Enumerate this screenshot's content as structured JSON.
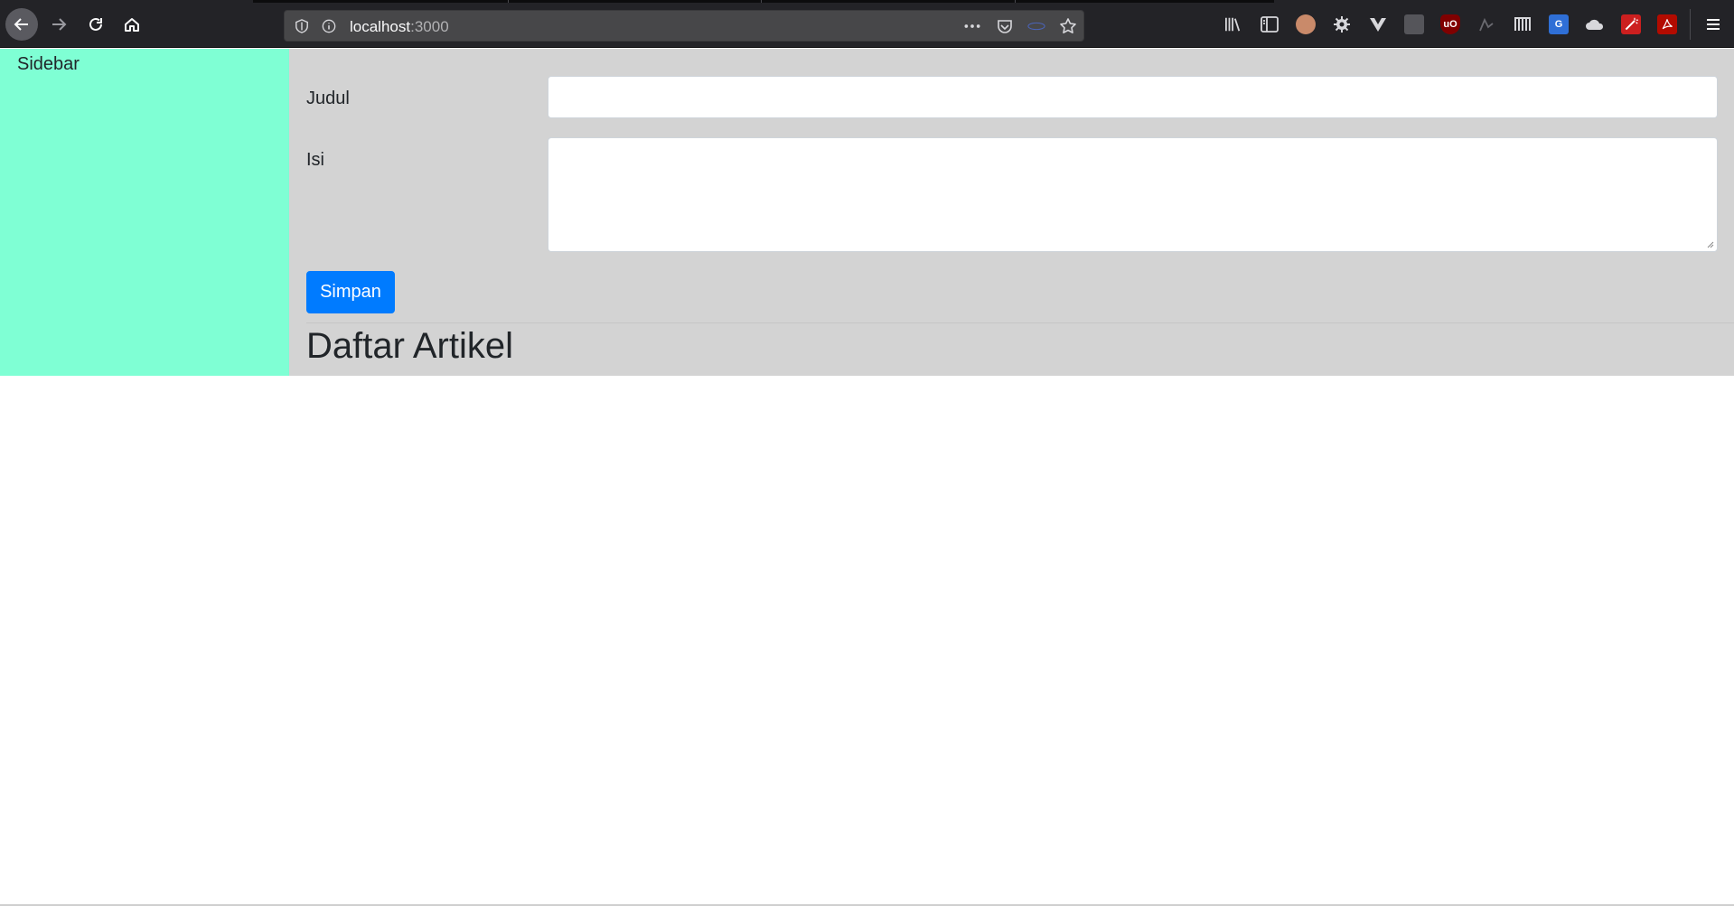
{
  "browser": {
    "url_host": "localhost",
    "url_port": ":3000",
    "icons": {
      "back": "arrow-left-icon",
      "forward": "arrow-right-icon",
      "reload": "reload-icon",
      "home": "home-icon",
      "shield": "tracking-protection-shield-icon",
      "info": "site-info-icon",
      "page_actions": "more-actions-icon",
      "pocket": "pocket-icon",
      "bookmark": "bookmark-star-icon",
      "menu": "hamburger-menu-icon"
    }
  },
  "sidebar": {
    "title": "Sidebar",
    "bg_color": "#7fffd4"
  },
  "form": {
    "title_label": "Judul",
    "title_value": "",
    "content_label": "Isi",
    "content_value": "",
    "submit_label": "Simpan",
    "submit_color": "#007bff"
  },
  "main": {
    "bg_color": "#d3d3d3",
    "list_heading": "Daftar Artikel"
  }
}
